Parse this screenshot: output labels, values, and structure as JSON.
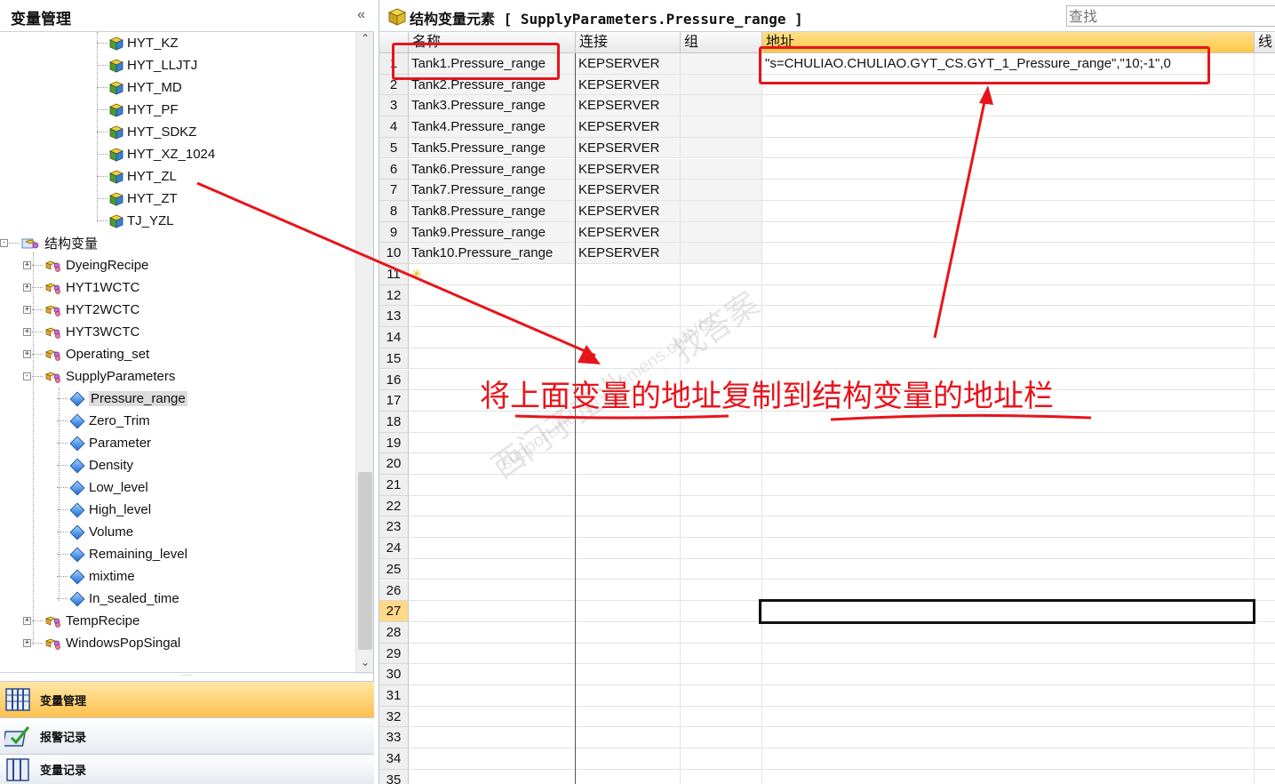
{
  "left_panel": {
    "title": "变量管理",
    "collapse_glyph": "«",
    "tree": {
      "tags_top": [
        "HYT_KZ",
        "HYT_LLJTJ",
        "HYT_MD",
        "HYT_PF",
        "HYT_SDKZ",
        "HYT_XZ_1024",
        "HYT_ZL",
        "HYT_ZT",
        "TJ_YZL"
      ],
      "struct_root": "结构变量",
      "structs_a": [
        "DyeingRecipe",
        "HYT1WCTC",
        "HYT2WCTC",
        "HYT3WCTC",
        "Operating_set"
      ],
      "supply": "SupplyParameters",
      "supply_children": [
        "Pressure_range",
        "Zero_Trim",
        "Parameter",
        "Density",
        "Low_level",
        "High_level",
        "Volume",
        "Remaining_level",
        "mixtime",
        "In_sealed_time"
      ],
      "structs_b": [
        "TempRecipe",
        "WindowsPopSingal"
      ]
    },
    "nav": [
      {
        "label": "变量管理",
        "icon": "variable-grid-icon"
      },
      {
        "label": "报警记录",
        "icon": "alarm-check-icon"
      },
      {
        "label": "变量记录",
        "icon": "tag-log-icon"
      }
    ]
  },
  "right_panel": {
    "title": "结构变量元素 [ SupplyParameters.Pressure_range ]",
    "search_placeholder": "查找",
    "columns": [
      "名称",
      "连接",
      "组",
      "地址",
      "线"
    ],
    "rows": [
      {
        "num": "1",
        "name": "Tank1.Pressure_range",
        "conn": "KEPSERVER",
        "group": "",
        "addr": "\"s=CHULIAO.CHULIAO.GYT_CS.GYT_1_Pressure_range\",\"10;-1\",0"
      },
      {
        "num": "2",
        "name": "Tank2.Pressure_range",
        "conn": "KEPSERVER",
        "group": "",
        "addr": ""
      },
      {
        "num": "3",
        "name": "Tank3.Pressure_range",
        "conn": "KEPSERVER",
        "group": "",
        "addr": ""
      },
      {
        "num": "4",
        "name": "Tank4.Pressure_range",
        "conn": "KEPSERVER",
        "group": "",
        "addr": ""
      },
      {
        "num": "5",
        "name": "Tank5.Pressure_range",
        "conn": "KEPSERVER",
        "group": "",
        "addr": ""
      },
      {
        "num": "6",
        "name": "Tank6.Pressure_range",
        "conn": "KEPSERVER",
        "group": "",
        "addr": ""
      },
      {
        "num": "7",
        "name": "Tank7.Pressure_range",
        "conn": "KEPSERVER",
        "group": "",
        "addr": ""
      },
      {
        "num": "8",
        "name": "Tank8.Pressure_range",
        "conn": "KEPSERVER",
        "group": "",
        "addr": ""
      },
      {
        "num": "9",
        "name": "Tank9.Pressure_range",
        "conn": "KEPSERVER",
        "group": "",
        "addr": ""
      },
      {
        "num": "10",
        "name": "Tank10.Pressure_range",
        "conn": "KEPSERVER",
        "group": "",
        "addr": ""
      }
    ],
    "empty_row_numbers": [
      "11",
      "12",
      "13",
      "14",
      "15",
      "16",
      "17",
      "18",
      "19",
      "20",
      "21",
      "22",
      "23",
      "24",
      "25",
      "26",
      "27",
      "28",
      "29",
      "30",
      "31",
      "32",
      "33",
      "34",
      "35"
    ],
    "active_row": "27"
  },
  "annotation": {
    "text": "将上面变量的地址复制到结构变量的地址栏",
    "color": "#e8141b"
  },
  "watermark": {
    "cn": "西门子工业",
    "cn2": "找答案",
    "url": "support.industry.siemens.com/cs"
  }
}
